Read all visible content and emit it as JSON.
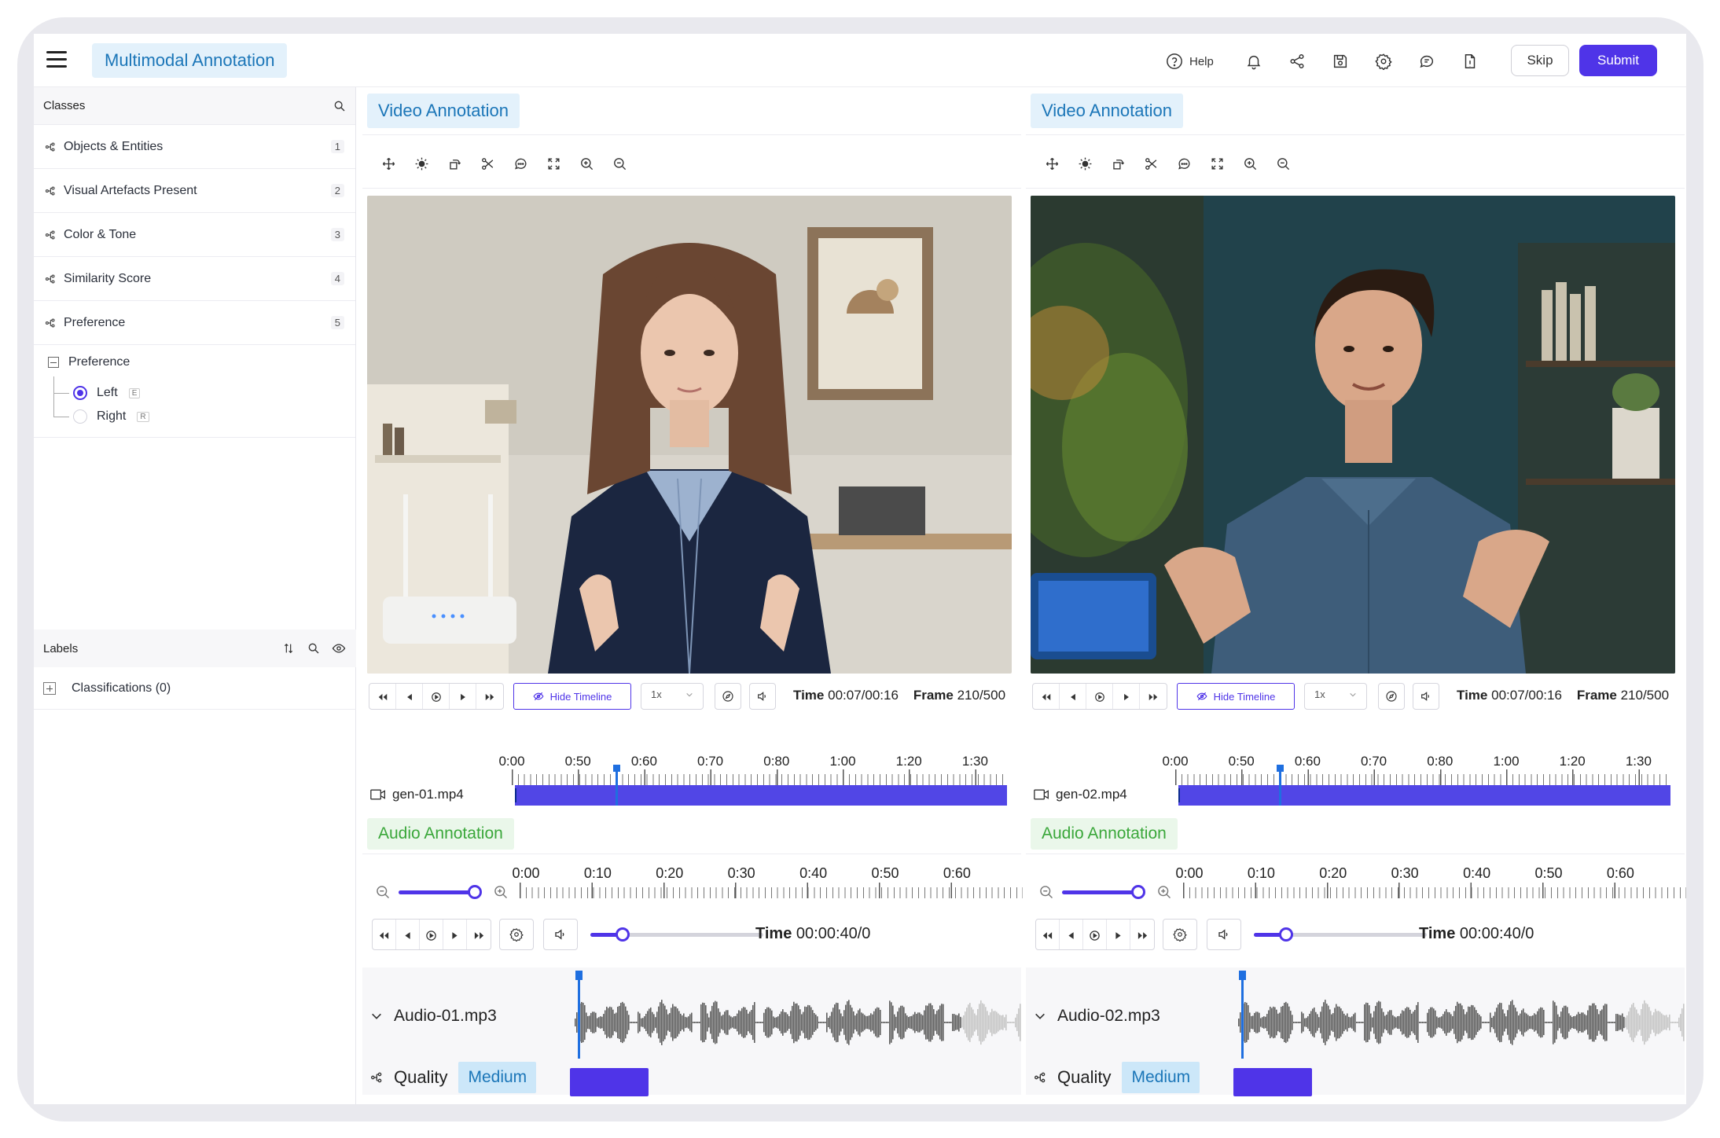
{
  "app": {
    "title": "Multimodal Annotation",
    "help_label": "Help",
    "skip_label": "Skip",
    "submit_label": "Submit",
    "accent_color": "#4f34e8"
  },
  "sidebar": {
    "classes_title": "Classes",
    "items": [
      {
        "label": "Objects & Entities",
        "num": "1"
      },
      {
        "label": "Visual Artefacts Present",
        "num": "2"
      },
      {
        "label": "Color & Tone",
        "num": "3"
      },
      {
        "label": "Similarity Score",
        "num": "4"
      },
      {
        "label": "Preference",
        "num": "5"
      }
    ],
    "preference_group": {
      "label": "Preference",
      "options": [
        {
          "label": "Left",
          "key": "E",
          "selected": true
        },
        {
          "label": "Right",
          "key": "R",
          "selected": false
        }
      ]
    },
    "labels_title": "Labels",
    "classifications": "Classifications (0)"
  },
  "panels": [
    {
      "video_title": "Video Annotation",
      "file": "gen-01.mp4",
      "hide_timeline": "Hide Timeline",
      "speed": "1x",
      "time_label": "Time",
      "time_value": "00:07/00:16",
      "frame_label": "Frame",
      "frame_value": "210/500",
      "ruler": [
        "0:00",
        "0:50",
        "0:60",
        "0:70",
        "0:80",
        "1:00",
        "1:20",
        "1:30"
      ],
      "audio_title": "Audio Annotation",
      "audio_ruler": [
        "0:00",
        "0:10",
        "0:20",
        "0:30",
        "0:40",
        "0:50",
        "0:60"
      ],
      "audio_time_label": "Time",
      "audio_time_value": "00:00:40/0",
      "audio_file": "Audio-01.mp3",
      "quality_label": "Quality",
      "quality_value": "Medium"
    },
    {
      "video_title": "Video Annotation",
      "file": "gen-02.mp4",
      "hide_timeline": "Hide Timeline",
      "speed": "1x",
      "time_label": "Time",
      "time_value": "00:07/00:16",
      "frame_label": "Frame",
      "frame_value": "210/500",
      "ruler": [
        "0:00",
        "0:50",
        "0:60",
        "0:70",
        "0:80",
        "1:00",
        "1:20",
        "1:30"
      ],
      "audio_title": "Audio Annotation",
      "audio_ruler": [
        "0:00",
        "0:10",
        "0:20",
        "0:30",
        "0:40",
        "0:50",
        "0:60"
      ],
      "audio_time_label": "Time",
      "audio_time_value": "00:00:40/0",
      "audio_file": "Audio-02.mp3",
      "quality_label": "Quality",
      "quality_value": "Medium"
    }
  ]
}
